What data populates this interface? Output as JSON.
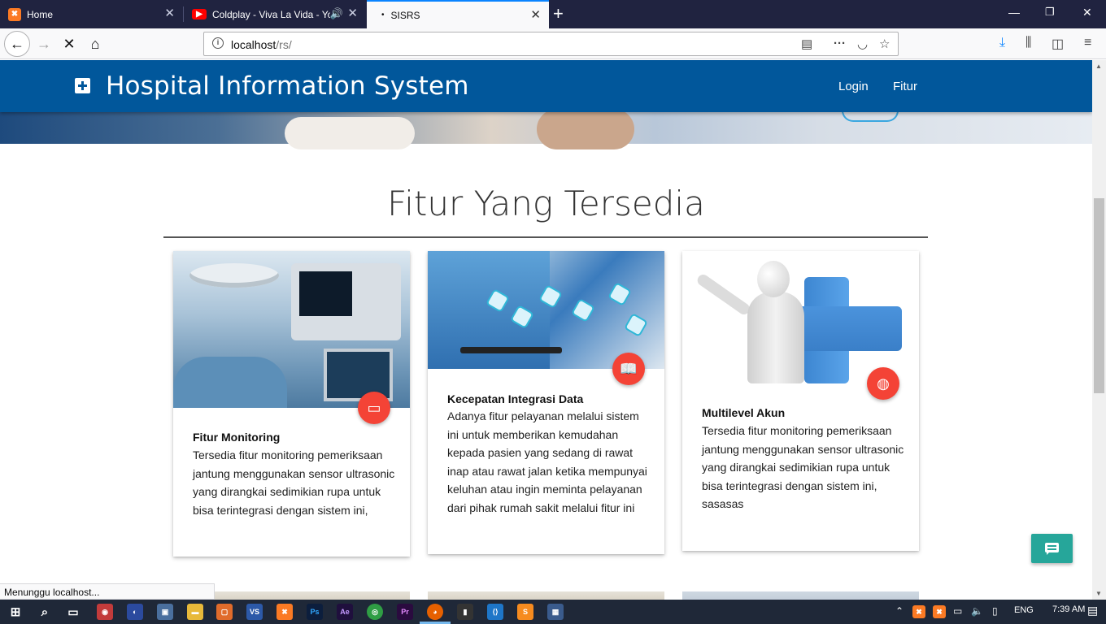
{
  "browser": {
    "tabs": [
      {
        "title": "Home",
        "icon": "xampp-icon",
        "color": "#fb7a24"
      },
      {
        "title": "Coldplay - Viva La Vida - Yo",
        "icon": "youtube-icon",
        "color": "#ff0000"
      },
      {
        "title": "SISRS",
        "icon": "loading-dot-icon"
      }
    ],
    "url": {
      "host": "localhost",
      "path": "/rs/"
    },
    "status": "Menunggu localhost..."
  },
  "site": {
    "brand": "Hospital Information System",
    "menu": [
      "Login",
      "Fitur"
    ],
    "section_title": "Fitur Yang Tersedia",
    "primary_color": "#01579b",
    "fab_color": "#f44336",
    "chat_color": "#26a69a",
    "cards": [
      {
        "title": "Fitur Monitoring",
        "icon": "devices-icon",
        "text": "Tersedia fitur monitoring pemeriksaan jantung menggunakan sensor ultrasonic yang dirangkai sedimikian rupa untuk bisa terintegrasi dengan sistem ini,"
      },
      {
        "title": "Kecepatan Integrasi Data",
        "icon": "book-icon",
        "text": "Adanya fitur pelayanan melalui sistem ini untuk memberikan kemudahan kepada pasien yang sedang di rawat inap atau rawat jalan ketika mempunyai keluhan atau ingin meminta pelayanan dari pihak rumah sakit melalui fitur ini"
      },
      {
        "title": "Multilevel Akun",
        "icon": "globe-icon",
        "text": "Tersedia fitur monitoring pemeriksaan jantung menggunakan sensor ultrasonic yang dirangkai sedimikian rupa untuk bisa terintegrasi dengan sistem ini, sasasas"
      }
    ]
  },
  "taskbar": {
    "language": "ENG",
    "time": "7:39 AM"
  }
}
